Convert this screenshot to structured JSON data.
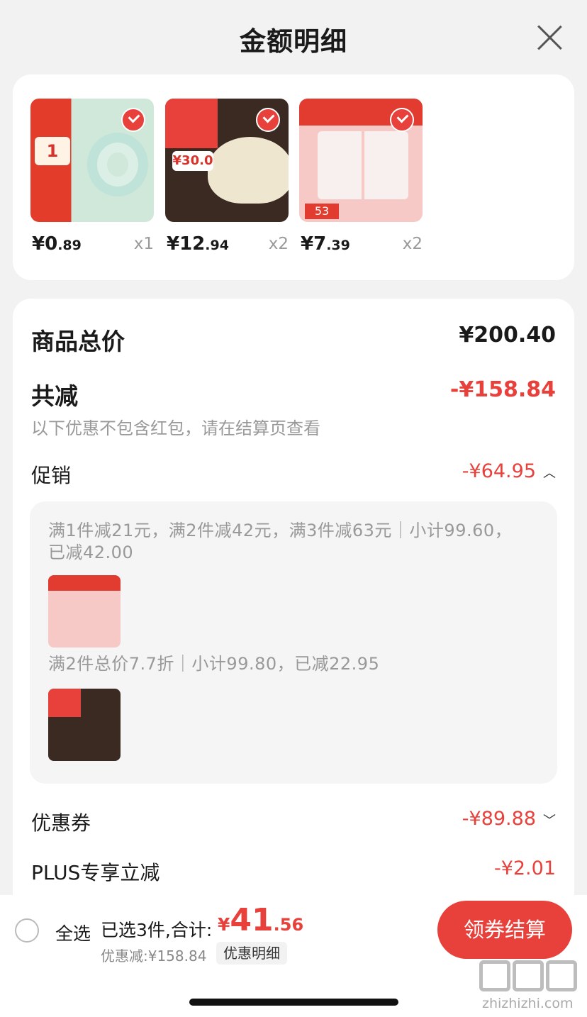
{
  "header": {
    "title": "金额明细"
  },
  "products": [
    {
      "price_int": "¥0",
      "price_dec": ".89",
      "qty": "x1",
      "badge": "1"
    },
    {
      "price_int": "¥12",
      "price_dec": ".94",
      "qty": "x2",
      "badge": "¥30.0"
    },
    {
      "price_int": "¥7",
      "price_dec": ".39",
      "qty": "x2",
      "badge": "53"
    }
  ],
  "summary": {
    "total_label": "商品总价",
    "total_value": "¥200.40",
    "reduce_label": "共减",
    "reduce_value": "-¥158.84",
    "reduce_note": "以下优惠不包含红包，请在结算页查看",
    "promo_label": "促销",
    "promo_value": "-¥64.95",
    "promo_rules": [
      "满1件减21元，满2件减42元，满3件减63元｜小计99.60，已减42.00",
      "满2件总价7.7折｜小计99.80，已减22.95"
    ],
    "coupon_label": "优惠券",
    "coupon_value": "-¥89.88",
    "plus_label": "PLUS专享立减",
    "plus_value": "-¥2.01"
  },
  "footer": {
    "select_all": "全选",
    "selected_text": "已选3件,合计:",
    "total_currency": "¥",
    "total_int": "41",
    "total_dec": ".56",
    "discount_text": "优惠减:¥158.84",
    "discount_detail": "优惠明细",
    "checkout": "领券结算"
  },
  "watermark": {
    "text": "zhizhizhi.com"
  },
  "colors": {
    "accent": "#e8403a"
  }
}
